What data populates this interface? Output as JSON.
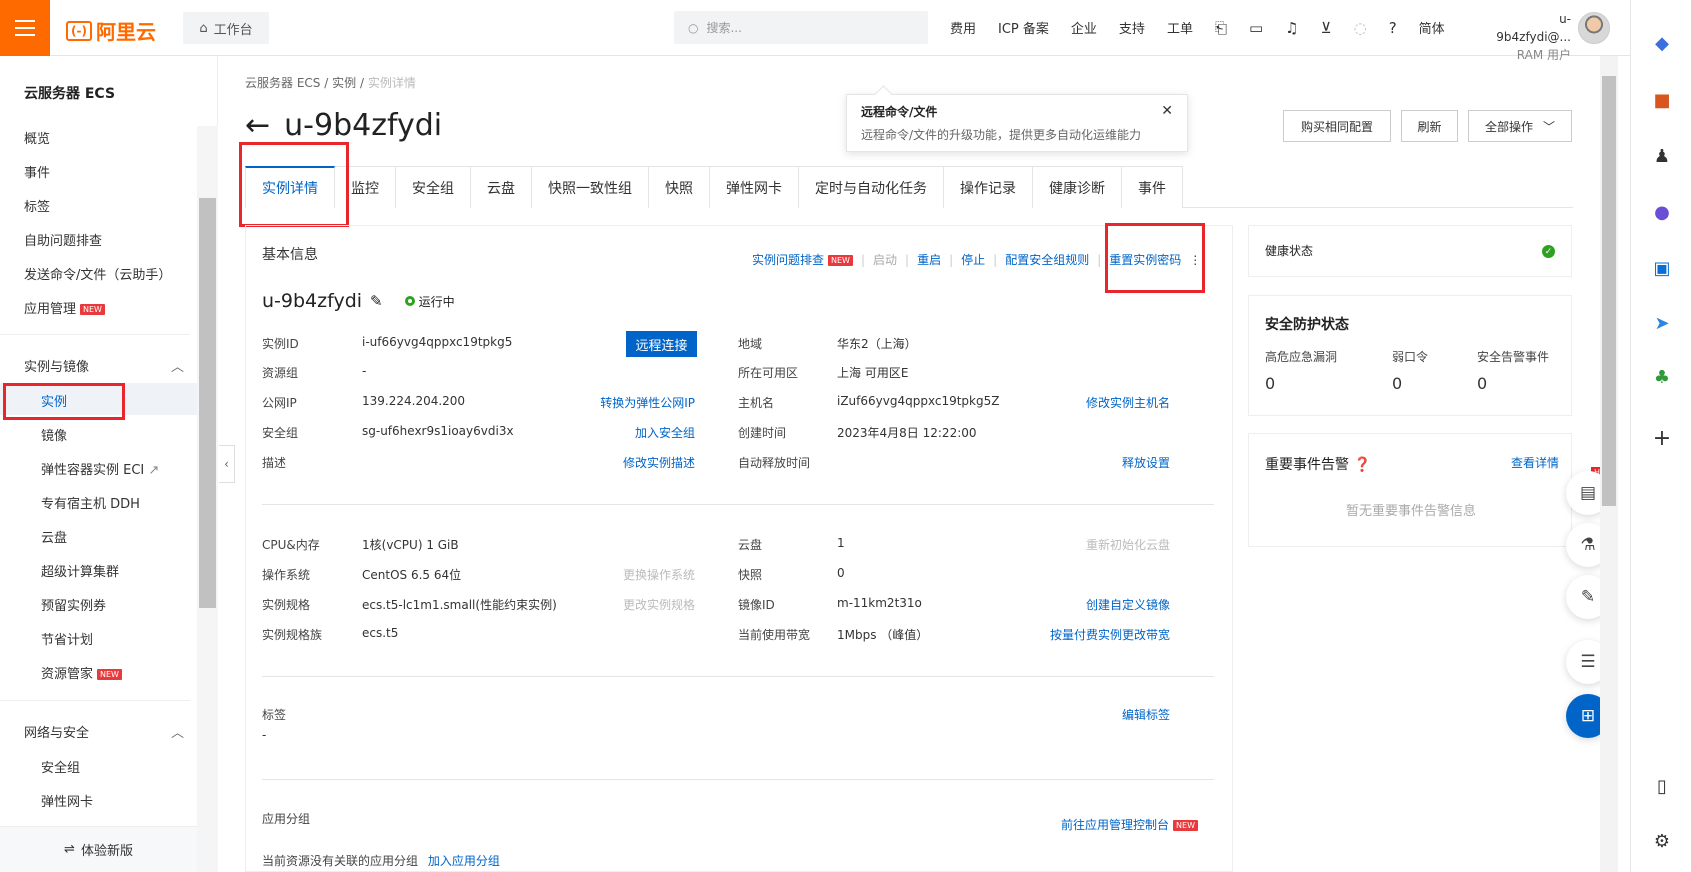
{
  "topbar": {
    "logo": "阿里云",
    "workbench": "工作台",
    "search_placeholder": "搜索...",
    "nav": [
      "费用",
      "ICP 备案",
      "企业",
      "支持",
      "工单"
    ],
    "lang": "简体",
    "user_name": "u-9b4zfydi@...",
    "user_role": "RAM 用户"
  },
  "sidebar": {
    "title": "云服务器 ECS",
    "items_top": [
      "概览",
      "事件",
      "标签",
      "自助问题排查",
      "发送命令/文件（云助手）",
      "应用管理"
    ],
    "group1": "实例与镜像",
    "group1_items": [
      "实例",
      "镜像",
      "弹性容器实例 ECI",
      "专有宿主机 DDH",
      "云盘",
      "超级计算集群",
      "预留实例券",
      "节省计划",
      "资源管家"
    ],
    "group2": "网络与安全",
    "group2_items": [
      "安全组",
      "弹性网卡"
    ],
    "new_badge": "NEW",
    "footer": "体验新版"
  },
  "breadcrumb": [
    "云服务器 ECS",
    "/",
    "实例",
    "/",
    "实例详情"
  ],
  "page": {
    "title": "u-9b4zfydi",
    "buttons": [
      "购买相同配置",
      "刷新",
      "全部操作"
    ]
  },
  "tooltip": {
    "title": "远程命令/文件",
    "desc": "远程命令/文件的升级功能，提供更多自动化运维能力"
  },
  "tabs": [
    "实例详情",
    "监控",
    "安全组",
    "云盘",
    "快照一致性组",
    "快照",
    "弹性网卡",
    "定时与自动化任务",
    "操作记录",
    "健康诊断",
    "事件"
  ],
  "basic": {
    "section": "基本信息",
    "actions": [
      "实例问题排查",
      "启动",
      "重启",
      "停止",
      "配置安全组规则",
      "重置实例密码"
    ],
    "name": "u-9b4zfydi",
    "status": "运行中",
    "remote_btn": "远程连接",
    "left": [
      {
        "label": "实例ID",
        "value": "i-uf66yvg4qppxc19tpkg5",
        "action": ""
      },
      {
        "label": "资源组",
        "value": "-",
        "action": ""
      },
      {
        "label": "公网IP",
        "value": "139.224.204.200",
        "action": "转换为弹性公网IP"
      },
      {
        "label": "安全组",
        "value": "sg-uf6hexr9s1ioay6vdi3x",
        "action": "加入安全组"
      },
      {
        "label": "描述",
        "value": "",
        "action": "修改实例描述"
      }
    ],
    "right": [
      {
        "label": "地域",
        "value": "华东2（上海）",
        "action": ""
      },
      {
        "label": "所在可用区",
        "value": "上海 可用区E",
        "action": ""
      },
      {
        "label": "主机名",
        "value": "iZuf66yvg4qppxc19tpkg5Z",
        "action": "修改实例主机名"
      },
      {
        "label": "创建时间",
        "value": "2023年4月8日 12:22:00",
        "action": ""
      },
      {
        "label": "自动释放时间",
        "value": "",
        "action": "释放设置"
      }
    ]
  },
  "config": {
    "left": [
      {
        "label": "CPU&内存",
        "value": "1核(vCPU) 1 GiB",
        "action": ""
      },
      {
        "label": "操作系统",
        "value": "CentOS 6.5 64位",
        "action": "更换操作系统"
      },
      {
        "label": "实例规格",
        "value": "ecs.t5-lc1m1.small(性能约束实例)",
        "action": "更改实例规格"
      },
      {
        "label": "实例规格族",
        "value": "ecs.t5",
        "action": ""
      }
    ],
    "right": [
      {
        "label": "云盘",
        "value": "1",
        "action": "重新初始化云盘"
      },
      {
        "label": "快照",
        "value": "0",
        "action": ""
      },
      {
        "label": "镜像ID",
        "value": "m-11km2t31o",
        "action": "创建自定义镜像"
      },
      {
        "label": "当前使用带宽",
        "value": "1Mbps （峰值）",
        "action": "按量付费实例更改带宽"
      }
    ]
  },
  "tags": {
    "title": "标签",
    "value": "-",
    "action": "编辑标签"
  },
  "appgroup": {
    "title": "应用分组",
    "action": "前往应用管理控制台",
    "empty": "当前资源没有关联的应用分组",
    "add": "加入应用分组"
  },
  "health": {
    "label": "健康状态"
  },
  "security": {
    "title": "安全防护状态",
    "cols": [
      {
        "label": "高危应急漏洞",
        "value": "0"
      },
      {
        "label": "弱口令",
        "value": "0"
      },
      {
        "label": "安全告警事件",
        "value": "0"
      }
    ]
  },
  "events": {
    "title": "重要事件告警",
    "link": "查看详情",
    "empty": "暂无重要事件告警信息"
  },
  "float": {
    "hot": "HOT"
  }
}
